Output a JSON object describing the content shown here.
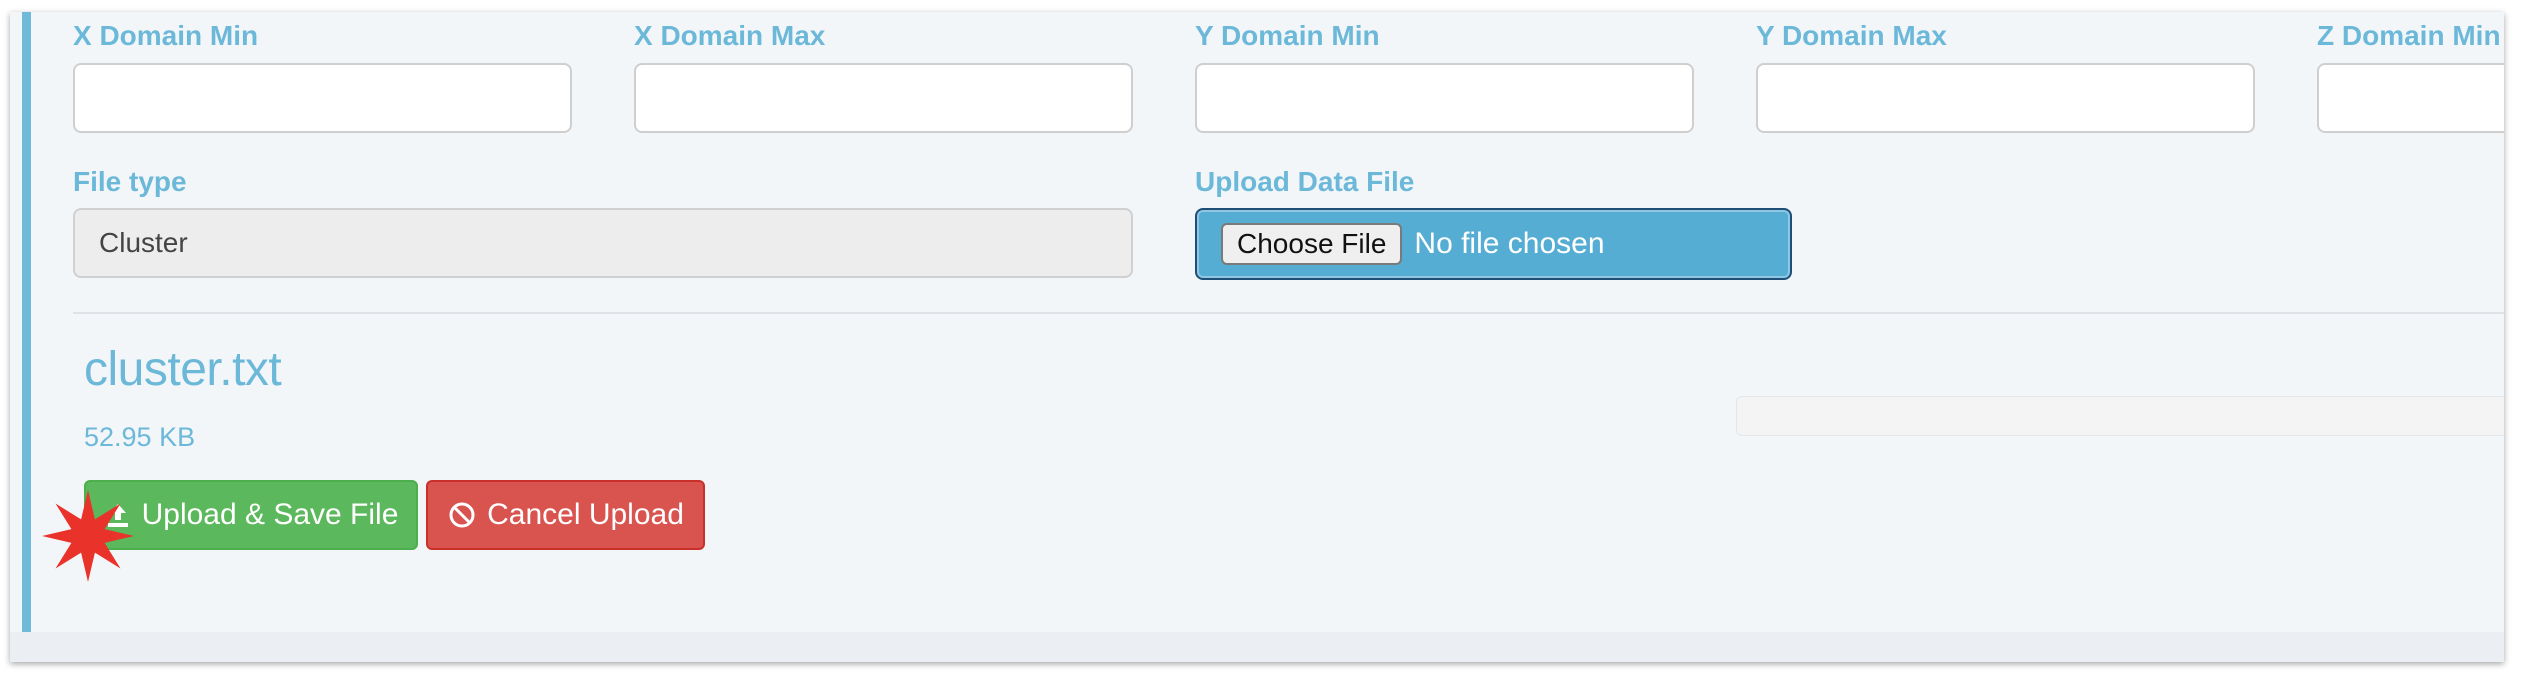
{
  "form": {
    "x_domain_min": {
      "label": "X Domain Min",
      "value": ""
    },
    "x_domain_max": {
      "label": "X Domain Max",
      "value": ""
    },
    "y_domain_min": {
      "label": "Y Domain Min",
      "value": ""
    },
    "y_domain_max": {
      "label": "Y Domain Max",
      "value": ""
    },
    "z_domain_min": {
      "label": "Z Domain Min",
      "value": ""
    },
    "file_type": {
      "label": "File type",
      "value": "Cluster"
    },
    "upload": {
      "label": "Upload Data File",
      "button_label": "Choose File",
      "status": "No file chosen"
    }
  },
  "upload_item": {
    "file_name": "cluster.txt",
    "file_size": "52.95 KB",
    "progress_fraction": 0,
    "upload_button_label": "Upload & Save File",
    "cancel_button_label": "Cancel Upload"
  },
  "icons": {
    "upload": "upload-icon",
    "cancel": "ban-icon",
    "marker": "red-burst-icon"
  },
  "colors": {
    "accent": "#6cb8d9",
    "upload_green": "#5cb85c",
    "cancel_red": "#d9534f",
    "file_input_blue": "#56add4",
    "marker_red": "#e8322a"
  }
}
